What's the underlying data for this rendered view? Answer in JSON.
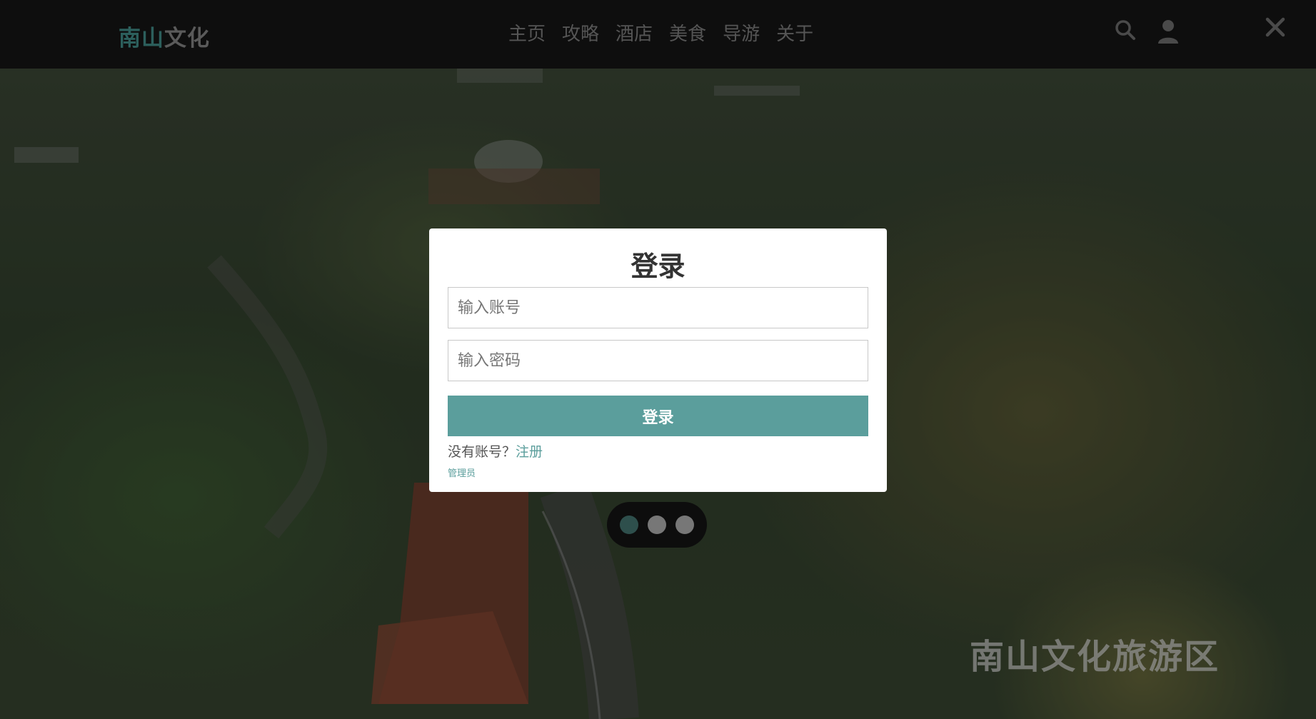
{
  "header": {
    "logo_part1": "南山",
    "logo_part2": "文化",
    "nav": [
      "主页",
      "攻略",
      "酒店",
      "美食",
      "导游",
      "关于"
    ],
    "icons": [
      "search-icon",
      "user-icon",
      "close-icon"
    ]
  },
  "hero": {
    "watermark": "南山文化旅游区"
  },
  "carousel": {
    "dot_count": 3,
    "active_index": 0
  },
  "login": {
    "title": "登录",
    "account_placeholder": "输入账号",
    "password_placeholder": "输入密码",
    "submit_label": "登录",
    "no_account_text": "没有账号？",
    "register_label": "注册",
    "admin_label": "管理员"
  },
  "colors": {
    "accent": "#5b9e9c",
    "logo_accent": "#2c5f5c",
    "header_bg": "#0e0e0e"
  }
}
